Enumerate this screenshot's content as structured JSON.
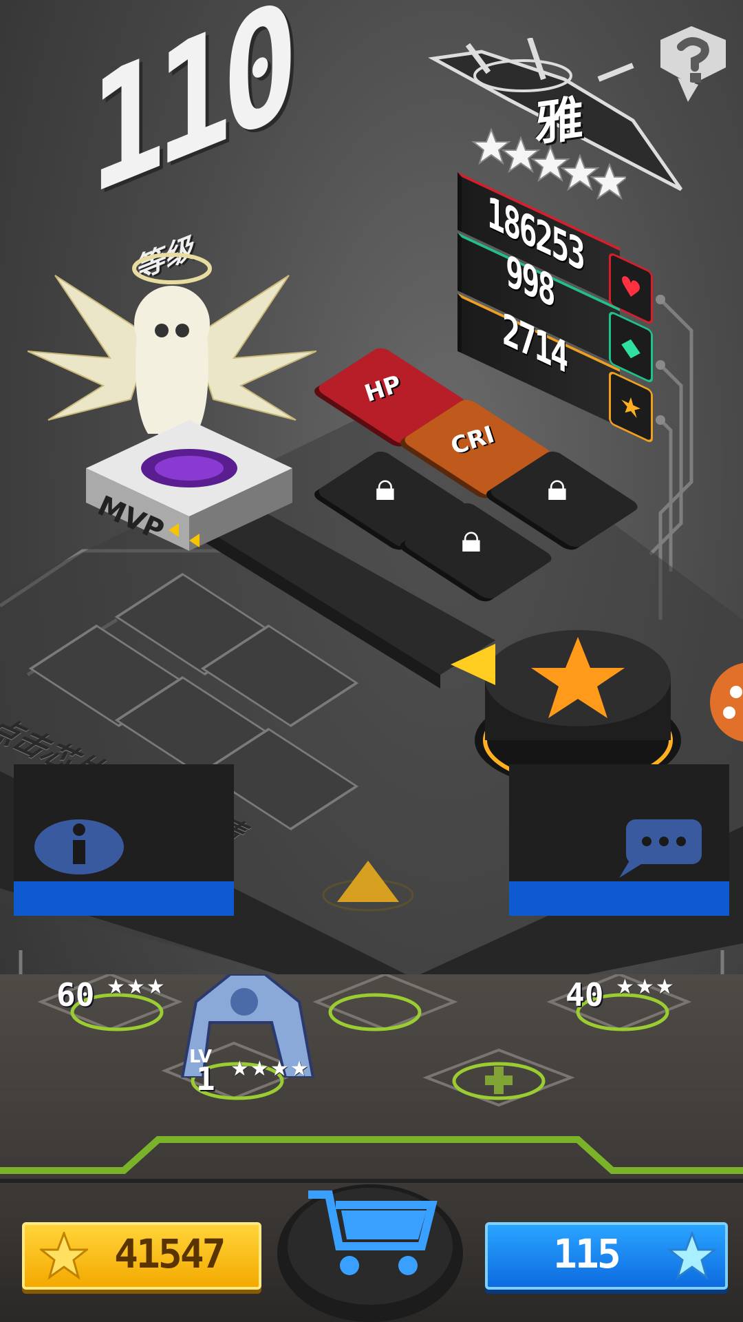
{
  "level": {
    "value": "110",
    "label": "等级"
  },
  "hero": {
    "name": "雅",
    "stars": 5,
    "badge": "MVP"
  },
  "stats": {
    "hp": "186253",
    "defense": "998",
    "attack": "2714"
  },
  "chips": {
    "hp_label": "HP",
    "crit_label": "CRI",
    "locked_count": 3
  },
  "hint": "点击芯片可查看详情",
  "squad": [
    {
      "level": "60",
      "stars": "★★★"
    },
    {
      "level_prefix": "LV",
      "level": "1",
      "stars": "★★★★"
    },
    {
      "level": "40",
      "stars": "★★★"
    }
  ],
  "currency": {
    "gold": "41547",
    "gems": "115"
  },
  "colors": {
    "gold": "#f4a900",
    "blue": "#0d6be0",
    "hp": "#d81e2c",
    "defense": "#1ec28a",
    "attack": "#f0a020",
    "slot_green": "#9acd32"
  },
  "icons": {
    "help": "question-mark-icon",
    "info": "info-icon",
    "chat": "speech-bubble-icon",
    "cart": "shopping-cart-icon",
    "star_button": "star-icon"
  }
}
